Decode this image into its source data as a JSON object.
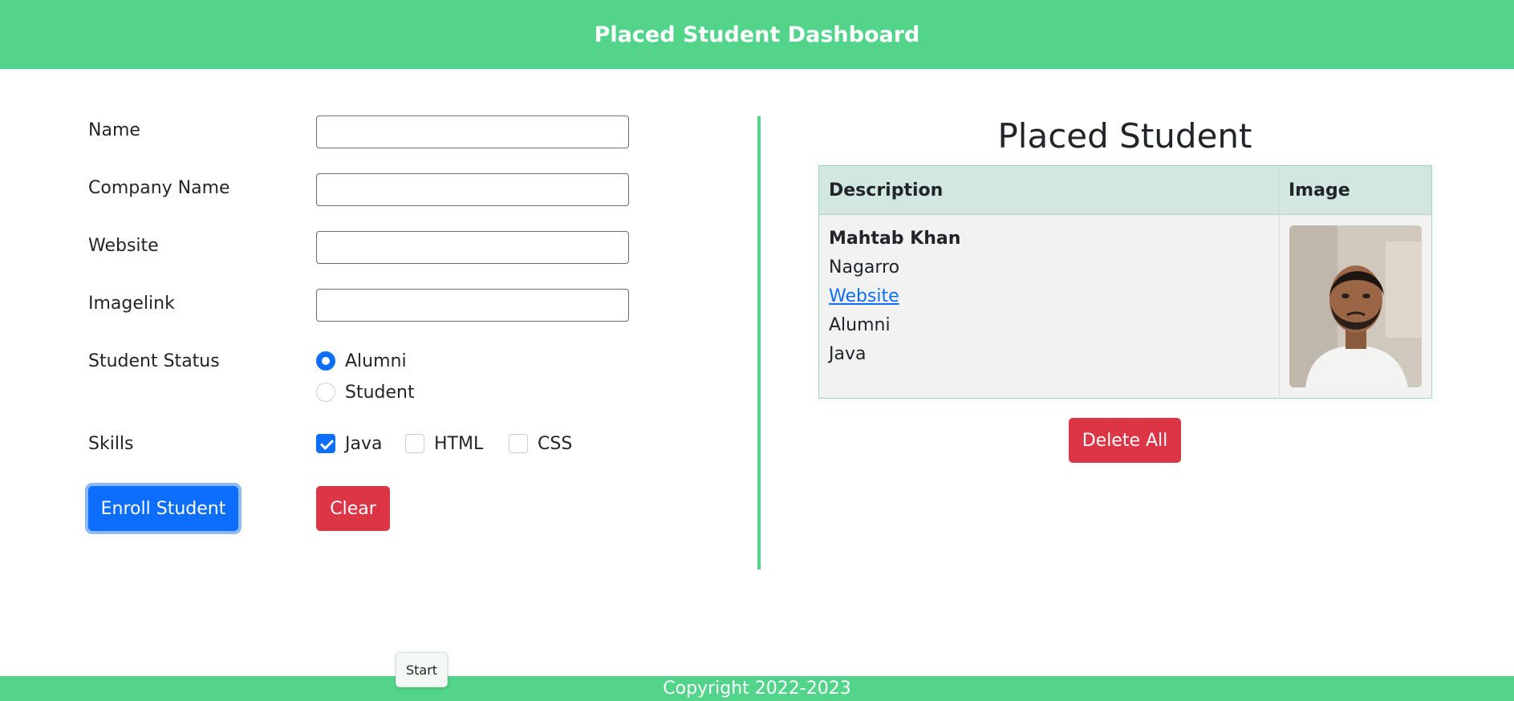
{
  "header": {
    "title": "Placed Student Dashboard"
  },
  "form": {
    "name_label": "Name",
    "name_value": "",
    "company_label": "Company Name",
    "company_value": "",
    "website_label": "Website",
    "website_value": "",
    "imagelink_label": "Imagelink",
    "imagelink_value": "",
    "status_label": "Student Status",
    "status_options": [
      {
        "label": "Alumni",
        "checked": true
      },
      {
        "label": "Student",
        "checked": false
      }
    ],
    "skills_label": "Skills",
    "skills_options": [
      {
        "label": "Java",
        "checked": true
      },
      {
        "label": "HTML",
        "checked": false
      },
      {
        "label": "CSS",
        "checked": false
      }
    ],
    "enroll_label": "Enroll Student",
    "clear_label": "Clear"
  },
  "right": {
    "title": "Placed Student",
    "table": {
      "headers": [
        "Description",
        "Image"
      ],
      "rows": [
        {
          "name": "Mahtab Khan",
          "company": "Nagarro",
          "website_text": "Website",
          "status": "Alumni",
          "skills": "Java",
          "image": "student-photo"
        }
      ]
    },
    "delete_label": "Delete All"
  },
  "tooltip": {
    "text": "Start"
  },
  "footer": {
    "text": "Copyright 2022-2023"
  },
  "colors": {
    "header": "#52d48b",
    "primary": "#0d6efd",
    "danger": "#dc3545",
    "table_head": "#d1e7df",
    "table_body": "#f2f2f2"
  }
}
